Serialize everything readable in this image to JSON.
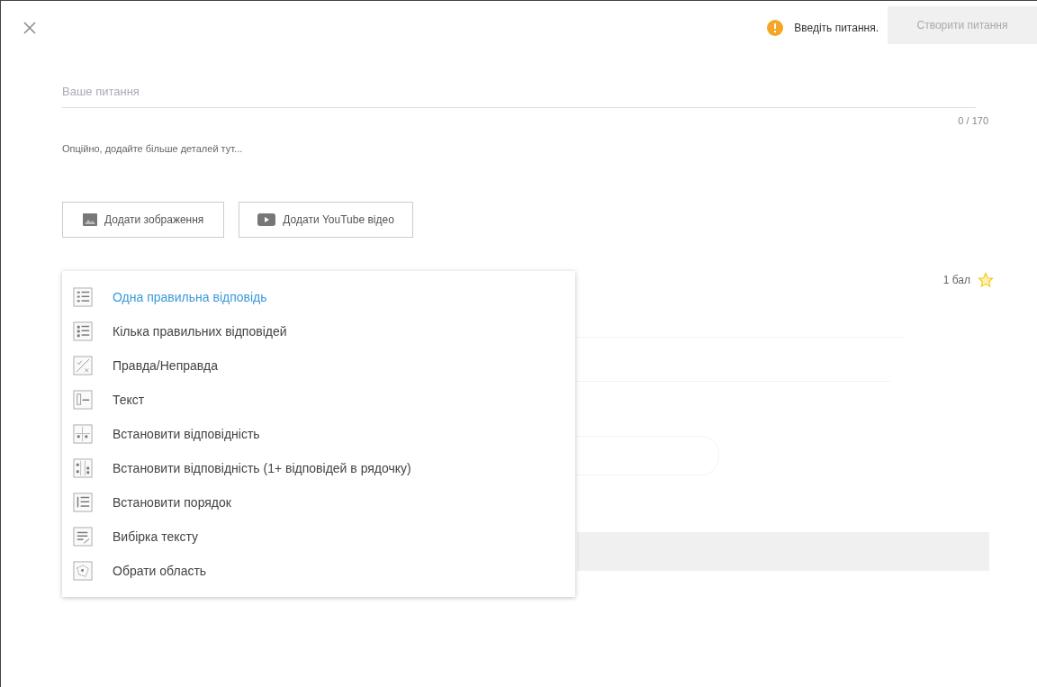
{
  "header": {
    "warning": "Введіть питання.",
    "create_button": {
      "label": "Створити питання",
      "disabled": true
    }
  },
  "question": {
    "placeholder": "Ваше питання",
    "counter": "0 / 170",
    "details_placeholder": "Опційно, додайте більше деталей тут..."
  },
  "media_buttons": [
    {
      "kind": "image",
      "label": "Додати зображення"
    },
    {
      "kind": "video",
      "label": "Додати YouTube відео"
    }
  ],
  "points": {
    "label": "1 бал"
  },
  "type_menu": [
    {
      "kind": "single",
      "label": "Одна правильна відповідь",
      "selected": true
    },
    {
      "kind": "multiple",
      "label": "Кілька правильних відповідей",
      "selected": false
    },
    {
      "kind": "truefalse",
      "label": "Правда/Неправда",
      "selected": false
    },
    {
      "kind": "text",
      "label": "Текст",
      "selected": false
    },
    {
      "kind": "match",
      "label": "Встановити відповідність",
      "selected": false
    },
    {
      "kind": "matchmulti",
      "label": "Встановити відповідність (1+ відповідей в рядочку)",
      "selected": false
    },
    {
      "kind": "order",
      "label": "Встановити порядок",
      "selected": false
    },
    {
      "kind": "select",
      "label": "Вибірка тексту",
      "selected": false
    },
    {
      "kind": "area",
      "label": "Обрати область",
      "selected": false
    }
  ]
}
